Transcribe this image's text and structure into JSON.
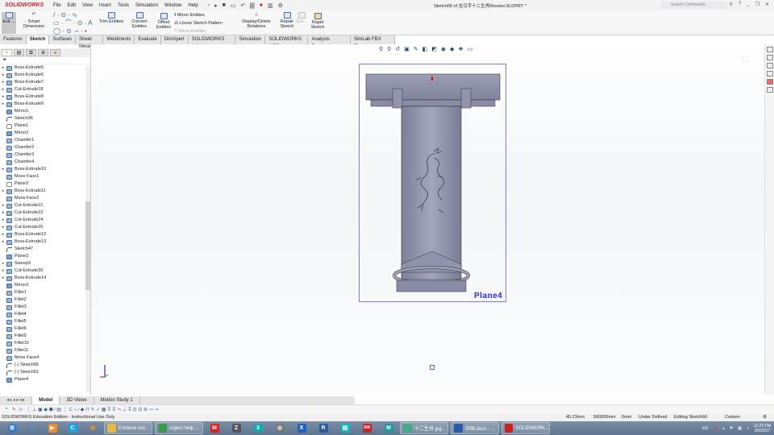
{
  "app": {
    "logo": "SOLIDWORKS",
    "doc_title": "Sketch66 of 吉汉字十二生肖Rooster.SLDPRT *",
    "search_placeholder": "Search Commands"
  },
  "menu": [
    "File",
    "Edit",
    "View",
    "Insert",
    "Tools",
    "Simulation",
    "Window",
    "Help"
  ],
  "ribbon": {
    "exit": "Exit ...",
    "smart_dimension": "Smart Dimension",
    "trim": "Trim Entities",
    "convert": "Convert Entities",
    "offset": "Offset Entities",
    "mirror": "Mirror Entities",
    "linear_pattern": "Linear Sketch Pattern",
    "move": "Move Entities",
    "relations": "Display/Delete Relations",
    "repair": "Repair Sketch",
    "quick": "Qui...",
    "rapid": "Rapid Sketch"
  },
  "tabs": [
    "Features",
    "Sketch",
    "Surfaces",
    "Sheet Metal",
    "Weldments",
    "Evaluate",
    "DimXpert",
    "SOLIDWORKS Add-Ins",
    "Simulation",
    "SOLIDWORKS MBD",
    "Analysis Preparation",
    "SimLab FBX Exporter"
  ],
  "active_tab": "Sketch",
  "tree": [
    {
      "label": "Boss-Extrude5",
      "icon": "extrude",
      "exp": true
    },
    {
      "label": "Boss-Extrude6",
      "icon": "extrude",
      "exp": true
    },
    {
      "label": "Boss-Extrude7",
      "icon": "extrude",
      "exp": true
    },
    {
      "label": "Cut-Extrude18",
      "icon": "extrude",
      "exp": true
    },
    {
      "label": "Boss-Extrude8",
      "icon": "extrude",
      "exp": true
    },
    {
      "label": "Boss-Extrude9",
      "icon": "extrude",
      "exp": true
    },
    {
      "label": "Mirror1",
      "icon": "mirror",
      "exp": false
    },
    {
      "label": "Sketch36",
      "icon": "sketch",
      "exp": false
    },
    {
      "label": "Plane1",
      "icon": "plane",
      "exp": false
    },
    {
      "label": "Mirror2",
      "icon": "mirror",
      "exp": false
    },
    {
      "label": "Chamfer1",
      "icon": "extrude",
      "exp": false
    },
    {
      "label": "Chamfer2",
      "icon": "extrude",
      "exp": false
    },
    {
      "label": "Chamfer3",
      "icon": "extrude",
      "exp": false
    },
    {
      "label": "Chamfer4",
      "icon": "extrude",
      "exp": false
    },
    {
      "label": "Boss-Extrude10",
      "icon": "extrude",
      "exp": true
    },
    {
      "label": "Move Face1",
      "icon": "extrude",
      "exp": false
    },
    {
      "label": "Plane2",
      "icon": "plane",
      "exp": false
    },
    {
      "label": "Boss-Extrude11",
      "icon": "extrude",
      "exp": true
    },
    {
      "label": "Move Face2",
      "icon": "extrude",
      "exp": false
    },
    {
      "label": "Cut-Extrude21",
      "icon": "extrude",
      "exp": true
    },
    {
      "label": "Cut-Extrude22",
      "icon": "extrude",
      "exp": true
    },
    {
      "label": "Cut-Extrude24",
      "icon": "extrude",
      "exp": true
    },
    {
      "label": "Cut-Extrude25",
      "icon": "extrude",
      "exp": true
    },
    {
      "label": "Boss-Extrude12",
      "icon": "extrude",
      "exp": true
    },
    {
      "label": "Boss-Extrude13",
      "icon": "extrude",
      "exp": true
    },
    {
      "label": "Sketch47",
      "icon": "sketch",
      "exp": false
    },
    {
      "label": "Plane3",
      "icon": "mirror",
      "exp": false
    },
    {
      "label": "Sweep3",
      "icon": "extrude",
      "exp": true
    },
    {
      "label": "Cut-Extrude26",
      "icon": "extrude",
      "exp": true
    },
    {
      "label": "Boss-Extrude14",
      "icon": "extrude",
      "exp": true
    },
    {
      "label": "Mirror3",
      "icon": "mirror",
      "exp": false
    },
    {
      "label": "Fillet1",
      "icon": "extrude",
      "exp": false
    },
    {
      "label": "Fillet2",
      "icon": "extrude",
      "exp": false
    },
    {
      "label": "Fillet3",
      "icon": "extrude",
      "exp": false
    },
    {
      "label": "Fillet4",
      "icon": "extrude",
      "exp": false
    },
    {
      "label": "Fillet5",
      "icon": "extrude",
      "exp": false
    },
    {
      "label": "Fillet6",
      "icon": "extrude",
      "exp": false
    },
    {
      "label": "Fillet9",
      "icon": "extrude",
      "exp": false
    },
    {
      "label": "Fillet10",
      "icon": "extrude",
      "exp": false
    },
    {
      "label": "Fillet11",
      "icon": "extrude",
      "exp": false
    },
    {
      "label": "Move Face4",
      "icon": "extrude",
      "exp": false
    },
    {
      "label": "(-) Sketch56",
      "icon": "sketch",
      "exp": false
    },
    {
      "label": "(-) Sketch61",
      "icon": "sketch",
      "exp": false
    },
    {
      "label": "Plane4",
      "icon": "mirror",
      "exp": false
    }
  ],
  "viewport": {
    "plane_label": "Plane4"
  },
  "bottom_tabs": [
    "Model",
    "3D Views",
    "Motion Study 1"
  ],
  "status": {
    "edition": "SOLIDWORKS Education Edition - Instructional Use Only",
    "x": "45.23mm",
    "y": "500000mm",
    "z": "0mm",
    "state": "Under Defined",
    "editing": "Editing Sketch66",
    "units": "Custom"
  },
  "taskbar": {
    "windows": [
      {
        "label": "Extreme red...",
        "color": "#e6b84a"
      },
      {
        "label": "urgent help ...",
        "color": "#3a9b4a"
      }
    ],
    "icons": [
      {
        "glyph": "M",
        "color": "#d22"
      },
      {
        "glyph": "Z",
        "color": "#555"
      },
      {
        "glyph": "3",
        "color": "#1aa"
      },
      {
        "glyph": "◎",
        "color": "#777"
      },
      {
        "glyph": "X",
        "color": "#2060c0"
      },
      {
        "glyph": "R",
        "color": "#2a5aa0"
      },
      {
        "glyph": "▤",
        "color": "#1bb"
      },
      {
        "glyph": "SW",
        "color": "#c22"
      },
      {
        "glyph": "M",
        "color": "#1a9a9a"
      }
    ],
    "windows2": [
      {
        "label": "十二生肖.jpg...",
        "color": "#4a8"
      },
      {
        "label": "中国.docx - ...",
        "color": "#2b5caa"
      },
      {
        "label": "SOLIDWORK...",
        "color": "#c22"
      }
    ],
    "lang": "EN",
    "time": "11:23 PM",
    "date": "3/6/2017"
  }
}
